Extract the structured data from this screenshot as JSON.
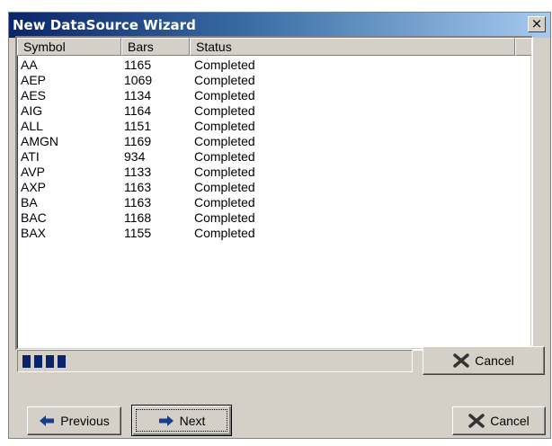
{
  "window": {
    "title": "New DataSource Wizard",
    "close_glyph": "×"
  },
  "table": {
    "columns": [
      "Symbol",
      "Bars",
      "Status"
    ],
    "rows": [
      {
        "symbol": "AA",
        "bars": "1165",
        "status": "Completed"
      },
      {
        "symbol": "AEP",
        "bars": "1069",
        "status": "Completed"
      },
      {
        "symbol": "AES",
        "bars": "1134",
        "status": "Completed"
      },
      {
        "symbol": "AIG",
        "bars": "1164",
        "status": "Completed"
      },
      {
        "symbol": "ALL",
        "bars": "1151",
        "status": "Completed"
      },
      {
        "symbol": "AMGN",
        "bars": "1169",
        "status": "Completed"
      },
      {
        "symbol": "ATI",
        "bars": "934",
        "status": "Completed"
      },
      {
        "symbol": "AVP",
        "bars": "1133",
        "status": "Completed"
      },
      {
        "symbol": "AXP",
        "bars": "1163",
        "status": "Completed"
      },
      {
        "symbol": "BA",
        "bars": "1163",
        "status": "Completed"
      },
      {
        "symbol": "BAC",
        "bars": "1168",
        "status": "Completed"
      },
      {
        "symbol": "BAX",
        "bars": "1155",
        "status": "Completed"
      }
    ]
  },
  "progress": {
    "filled_blocks": 4,
    "bar_color": "#0a246a"
  },
  "buttons": {
    "progress_cancel": {
      "label": "Cancel",
      "icon": "x-icon"
    },
    "previous": {
      "label": "Previous",
      "icon": "arrow-left-icon"
    },
    "next": {
      "label": "Next",
      "icon": "arrow-right-icon"
    },
    "cancel": {
      "label": "Cancel",
      "icon": "x-icon"
    }
  },
  "colors": {
    "title_bar_start": "#0a246a",
    "title_bar_end": "#a6caf0",
    "face": "#d4d0c8",
    "arrow_blue": "#1a3c8f",
    "x_dark": "#333333"
  }
}
